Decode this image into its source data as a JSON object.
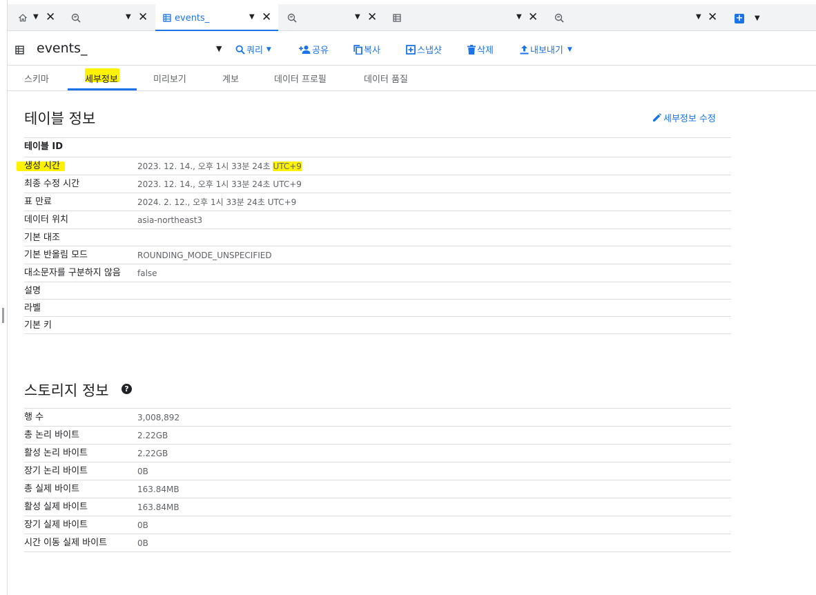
{
  "tabs": [
    {
      "label": "",
      "icon": "home-icon",
      "active": false
    },
    {
      "label": "",
      "icon": "query-icon",
      "active": false
    },
    {
      "label": "events_",
      "icon": "table-icon",
      "active": true
    },
    {
      "label": "",
      "icon": "query-icon",
      "active": false
    },
    {
      "label": "",
      "icon": "table-icon",
      "active": false
    },
    {
      "label": "",
      "icon": "query-icon",
      "active": false
    }
  ],
  "toolbar": {
    "title": "events_",
    "query_label": "쿼리",
    "share_label": "공유",
    "copy_label": "복사",
    "snapshot_label": "스냅샷",
    "delete_label": "삭제",
    "export_label": "내보내기"
  },
  "subtabs": [
    "스키마",
    "세부정보",
    "미리보기",
    "계보",
    "데이터 프로필",
    "데이터 품질"
  ],
  "active_subtab": "세부정보",
  "table_info": {
    "title": "테이블 정보",
    "edit_label": "세부정보 수정",
    "rows": [
      {
        "key": "테이블 ID",
        "value": ""
      },
      {
        "key": "생성 시간",
        "value": "2023. 12. 14., 오후 1시 33분 24초",
        "value_highlight": "UTC+9"
      },
      {
        "key": "최종 수정 시간",
        "value": "2023. 12. 14., 오후 1시 33분 24초 UTC+9"
      },
      {
        "key": "표 만료",
        "value": "2024. 2. 12., 오후 1시 33분 24초 UTC+9"
      },
      {
        "key": "데이터 위치",
        "value": "asia-northeast3"
      },
      {
        "key": "기본 대조",
        "value": ""
      },
      {
        "key": "기본 반올림 모드",
        "value": "ROUNDING_MODE_UNSPECIFIED"
      },
      {
        "key": "대소문자를 구분하지 않음",
        "value": "false"
      },
      {
        "key": "설명",
        "value": ""
      },
      {
        "key": "라벨",
        "value": ""
      },
      {
        "key": "기본 키",
        "value": ""
      }
    ]
  },
  "storage_info": {
    "title": "스토리지 정보",
    "help_glyph": "?",
    "rows": [
      {
        "key": "행 수",
        "value": "3,008,892"
      },
      {
        "key": "총 논리 바이트",
        "value": "2.22GB"
      },
      {
        "key": "활성 논리 바이트",
        "value": "2.22GB"
      },
      {
        "key": "장기 논리 바이트",
        "value": "0B"
      },
      {
        "key": "총 실제 바이트",
        "value": "163.84MB"
      },
      {
        "key": "활성 실제 바이트",
        "value": "163.84MB"
      },
      {
        "key": "장기 실제 바이트",
        "value": "0B"
      },
      {
        "key": "시간 이동 실제 바이트",
        "value": "0B"
      }
    ]
  },
  "colors": {
    "accent": "#1a73e8",
    "highlight": "#fff200"
  }
}
